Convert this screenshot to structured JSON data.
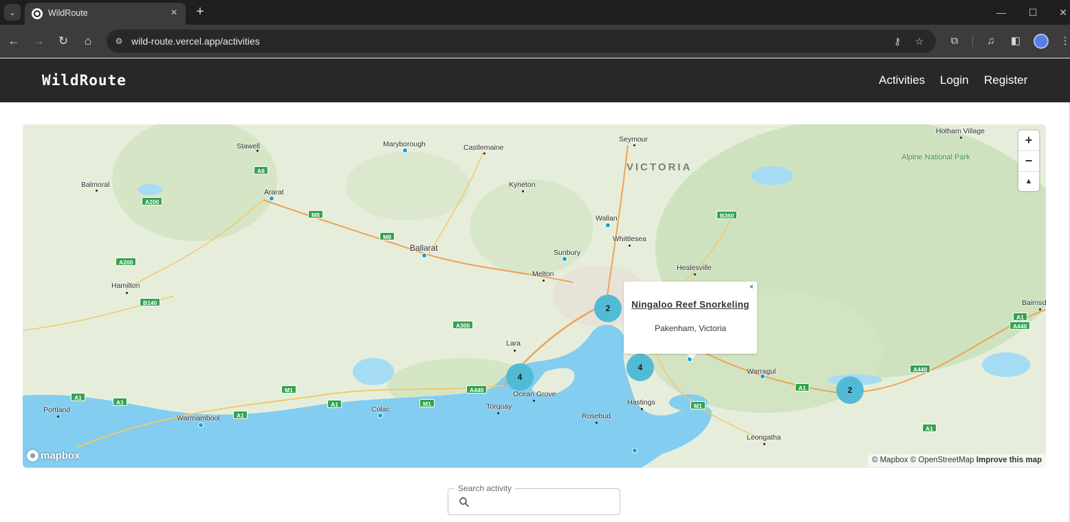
{
  "browser": {
    "tab_title": "WildRoute",
    "url": "wild-route.vercel.app/activities"
  },
  "nav": {
    "brand": "WildRoute",
    "links": [
      "Activities",
      "Login",
      "Register"
    ]
  },
  "map": {
    "region_label": "VICTORIA",
    "park_label": "Alpine National Park",
    "places": [
      {
        "name": "Stawell"
      },
      {
        "name": "Maryborough"
      },
      {
        "name": "Castlemaine"
      },
      {
        "name": "Seymour"
      },
      {
        "name": "Hotham Village"
      },
      {
        "name": "Balmoral"
      },
      {
        "name": "Ararat"
      },
      {
        "name": "Kyneton"
      },
      {
        "name": "Wallan"
      },
      {
        "name": "Ballarat"
      },
      {
        "name": "Whittlesea"
      },
      {
        "name": "Sunbury"
      },
      {
        "name": "Healesville"
      },
      {
        "name": "Melton"
      },
      {
        "name": "Hamilton"
      },
      {
        "name": "Bairnsdale"
      },
      {
        "name": "Lara"
      },
      {
        "name": "Warragul"
      },
      {
        "name": "Ocean Grove"
      },
      {
        "name": "Portland"
      },
      {
        "name": "Colac"
      },
      {
        "name": "Torquay"
      },
      {
        "name": "Hastings"
      },
      {
        "name": "Warrnambool"
      },
      {
        "name": "Rosebud"
      },
      {
        "name": "Leongatha"
      }
    ],
    "road_shields": [
      "A8",
      "A200",
      "M8",
      "M8",
      "A200",
      "B140",
      "A300",
      "B360",
      "A1",
      "A1",
      "A1",
      "A1",
      "M1",
      "A1",
      "M1",
      "A440",
      "M1",
      "A1",
      "A440",
      "A1",
      "A440"
    ],
    "clusters": [
      {
        "count": "2"
      },
      {
        "count": "4"
      },
      {
        "count": "4"
      },
      {
        "count": "2"
      }
    ],
    "popup": {
      "close": "×",
      "title": "Ningaloo Reef Snorkeling",
      "location": "Pakenham, Victoria"
    },
    "zoom_in": "+",
    "zoom_out": "−",
    "compass": "▲",
    "logo_text": "mapbox",
    "attribution": "© Mapbox © OpenStreetMap",
    "improve": "Improve this map"
  },
  "search": {
    "label": "Search activity",
    "value": ""
  }
}
